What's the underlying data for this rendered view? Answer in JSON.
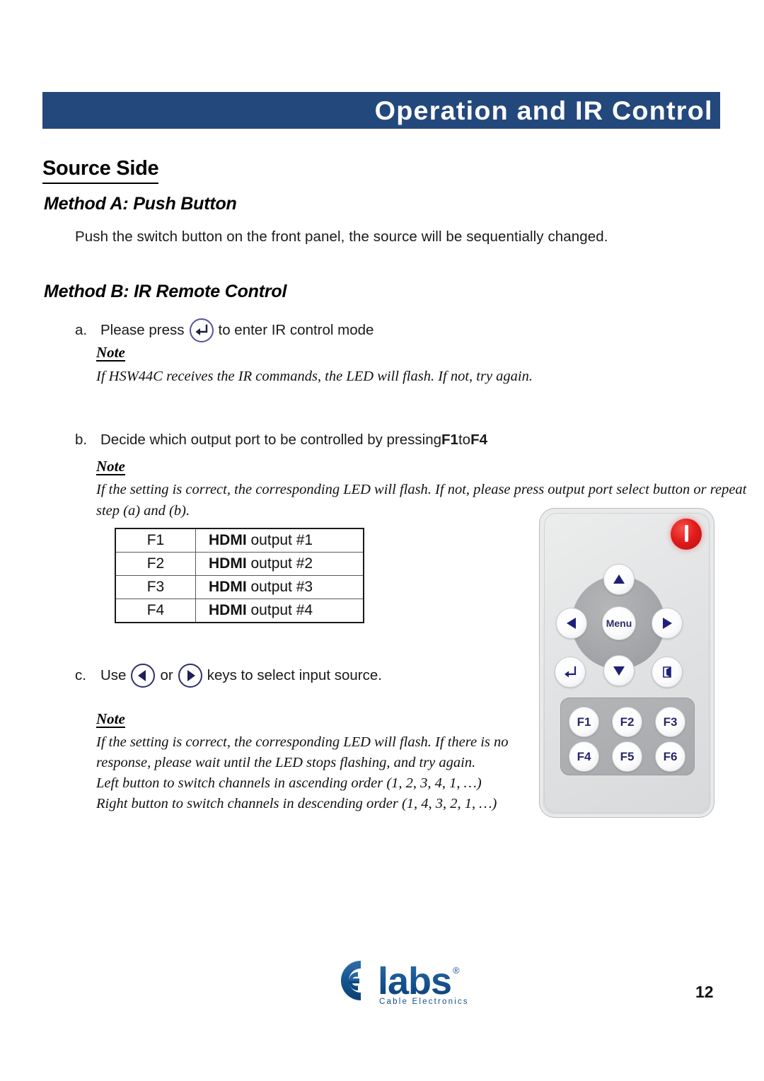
{
  "header": {
    "banner_title": "Operation and IR Control",
    "banner_color": "#23487c"
  },
  "section": {
    "title": "Source Side"
  },
  "method_a": {
    "heading": "Method A: Push Button",
    "paragraph": "Push the switch button on the front panel, the source will be sequentially changed."
  },
  "method_b": {
    "heading": "Method B: IR Remote Control",
    "step_a": {
      "marker": "a.",
      "text_before": "Please press",
      "text_after": "to enter IR control mode",
      "icon": "enter-key-icon"
    },
    "note_a": {
      "label": "Note",
      "lines": [
        "If HSW44C receives the IR commands, the LED will flash. If not, try again."
      ]
    },
    "step_b": {
      "marker": "b.",
      "text": "Decide which output port to be controlled by pressing ",
      "key_from": "F1",
      "text_mid": " to ",
      "key_to": "F4"
    },
    "note_b": {
      "label": "Note",
      "lines": [
        "If the setting is correct, the corresponding LED will flash. If not, please press output port select button or repeat",
        "step (a) and (b)."
      ]
    },
    "step_c": {
      "marker": "c.",
      "text_before": "Use",
      "text_or": "or",
      "text_after": "keys to select input source.",
      "icon_left": "arrow-left-icon",
      "icon_right": "arrow-right-icon"
    },
    "note_c": {
      "label": "Note",
      "lines": [
        "If the setting is correct, the corresponding LED will flash. If there is no",
        "response, please wait until the LED stops flashing, and try again.",
        "Left button to switch channels in ascending order (1, 2, 3, 4, 1, …)",
        "Right button to switch channels in descending order (1, 4, 3, 2, 1, …)"
      ]
    }
  },
  "fkey_table": {
    "rows": [
      {
        "key": "F1",
        "label_bold": "HDMI",
        "label_rest": " output #1"
      },
      {
        "key": "F2",
        "label_bold": "HDMI",
        "label_rest": " output #2"
      },
      {
        "key": "F3",
        "label_bold": "HDMI",
        "label_rest": " output #3"
      },
      {
        "key": "F4",
        "label_bold": "HDMI",
        "label_rest": " output #4"
      }
    ]
  },
  "remote": {
    "name": "ir-remote-control",
    "power_button": "power-icon",
    "menu_label": "Menu",
    "nav_up": "arrow-up-icon",
    "nav_down": "arrow-down-icon",
    "nav_left": "arrow-left-icon",
    "nav_right": "arrow-right-icon",
    "enter_button": "enter-key-icon",
    "exit_button": "exit-icon",
    "function_keys": [
      "F1",
      "F2",
      "F3",
      "F4",
      "F5",
      "F6"
    ],
    "accent_color": "#27276b",
    "power_color": "#e21d1d"
  },
  "footer": {
    "logo_mark": "CE",
    "logo_word": "labs",
    "logo_trademark": "®",
    "logo_subtitle": "Cable Electronics",
    "logo_color": "#1a4f8a",
    "page_number": "12"
  }
}
